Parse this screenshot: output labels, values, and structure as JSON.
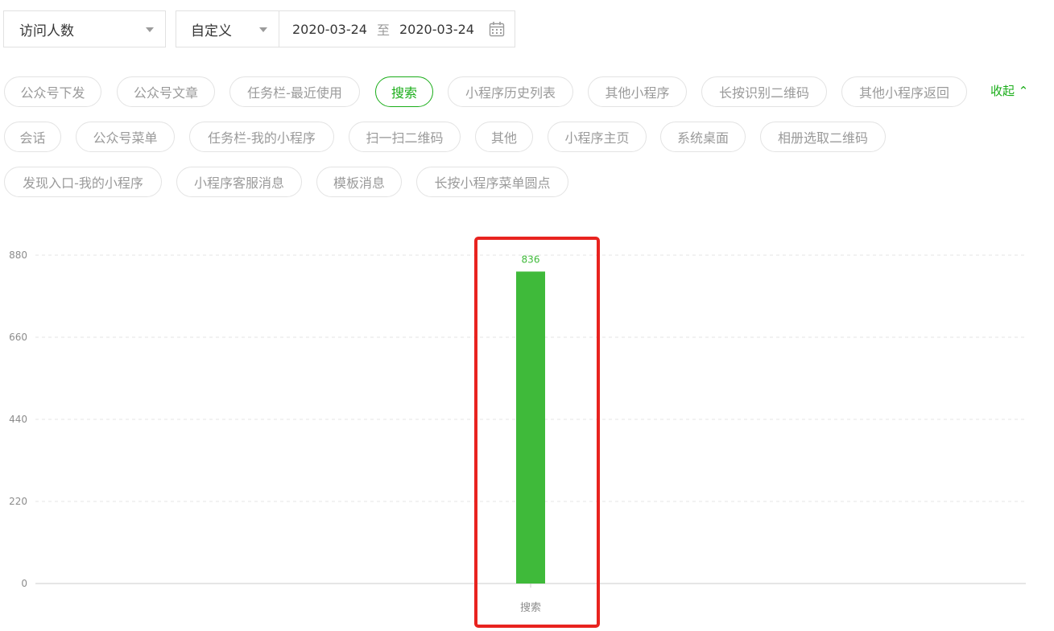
{
  "filters": {
    "metric": "访问人数",
    "range_type": "自定义",
    "start_date": "2020-03-24",
    "separator": "至",
    "end_date": "2020-03-24"
  },
  "tags": [
    "公众号下发",
    "公众号文章",
    "任务栏-最近使用",
    "搜索",
    "小程序历史列表",
    "其他小程序",
    "长按识别二维码",
    "其他小程序返回",
    "会话",
    "公众号菜单",
    "任务栏-我的小程序",
    "扫一扫二维码",
    "其他",
    "小程序主页",
    "系统桌面",
    "相册选取二维码",
    "发现入口-我的小程序",
    "小程序客服消息",
    "模板消息",
    "长按小程序菜单圆点"
  ],
  "active_tag": "搜索",
  "collapse_label": "收起",
  "colors": {
    "accent": "#1aad19",
    "bar": "#3fba3a",
    "highlight": "#e8231f"
  },
  "chart_data": {
    "type": "bar",
    "categories": [
      "搜索"
    ],
    "values": [
      836
    ],
    "data_labels": [
      "836"
    ],
    "ylim": [
      0,
      880
    ],
    "yticks": [
      0,
      220,
      440,
      660,
      880
    ],
    "grid": true,
    "title": "",
    "xlabel": "",
    "ylabel": ""
  }
}
